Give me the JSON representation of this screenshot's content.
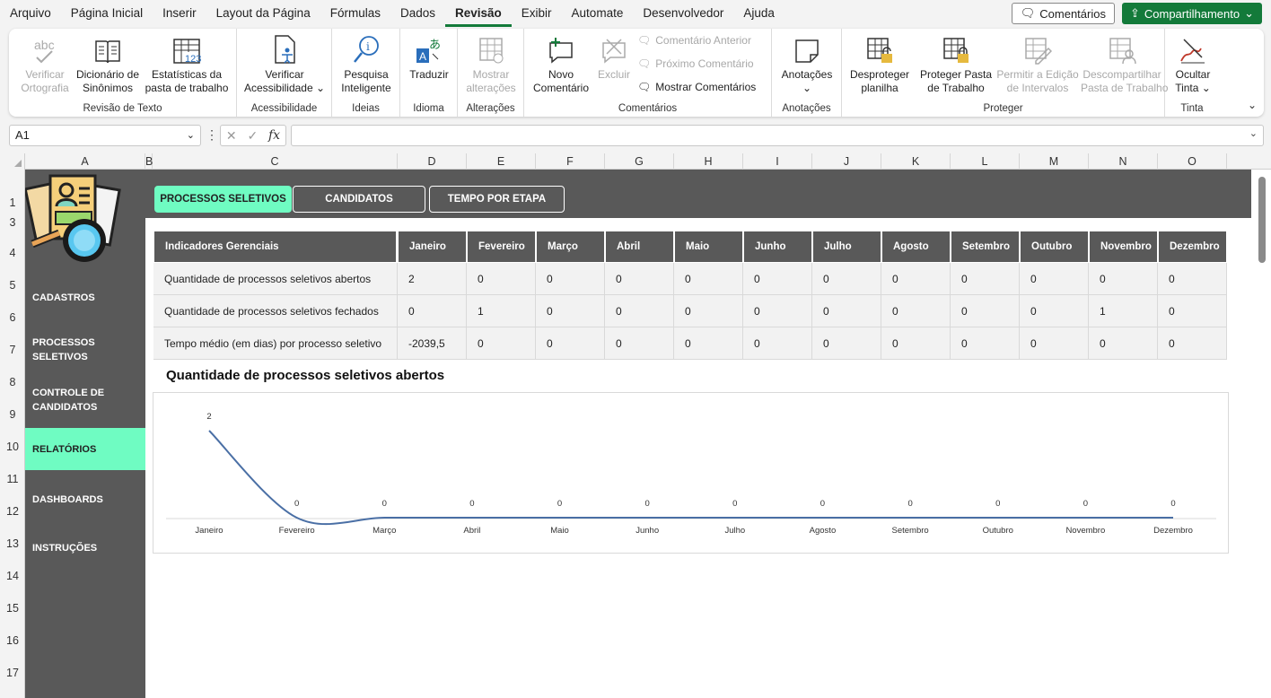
{
  "menu": [
    "Arquivo",
    "Página Inicial",
    "Inserir",
    "Layout da Página",
    "Fórmulas",
    "Dados",
    "Revisão",
    "Exibir",
    "Automate",
    "Desenvolvedor",
    "Ajuda"
  ],
  "active_menu": "Revisão",
  "top_buttons": {
    "comments": "Comentários",
    "share": "Compartilhamento"
  },
  "ribbon": {
    "revisao_texto": {
      "label": "Revisão de Texto",
      "verificar": "Verificar\nOrtografia",
      "dicionario": "Dicionário de\nSinônimos",
      "estatisticas": "Estatísticas da\npasta de trabalho"
    },
    "acessibilidade": {
      "label": "Acessibilidade",
      "verificar": "Verificar\nAcessibilidade ⌄"
    },
    "ideias": {
      "label": "Ideias",
      "pesquisa": "Pesquisa\nInteligente"
    },
    "idioma": {
      "label": "Idioma",
      "traduzir": "Traduzir"
    },
    "alteracoes": {
      "label": "Alterações",
      "mostrar": "Mostrar\nalterações"
    },
    "comentarios": {
      "label": "Comentários",
      "novo": "Novo\nComentário",
      "excluir": "Excluir",
      "anterior": "Comentário Anterior",
      "proximo": "Próximo Comentário",
      "mostrar": "Mostrar Comentários"
    },
    "anotacoes": {
      "label": "Anotações",
      "anotacoes": "Anotações\n⌄"
    },
    "proteger": {
      "label": "Proteger",
      "desproteger": "Desproteger\nplanilha",
      "proteger_pasta": "Proteger Pasta\nde Trabalho",
      "permitir": "Permitir a Edição\nde Intervalos",
      "descompartilhar": "Descompartilhar\nPasta de Trabalho"
    },
    "tinta": {
      "label": "Tinta",
      "ocultar": "Ocultar\nTinta ⌄"
    }
  },
  "namebox": "A1",
  "columns": [
    "A",
    "B",
    "C",
    "D",
    "E",
    "F",
    "G",
    "H",
    "I",
    "J",
    "K",
    "L",
    "M",
    "N",
    "O"
  ],
  "rows": [
    "1",
    "3",
    "4",
    "5",
    "6",
    "7",
    "8",
    "9",
    "10",
    "11",
    "12",
    "13",
    "14",
    "15",
    "16",
    "17"
  ],
  "tabs": [
    "PROCESSOS SELETIVOS",
    "CANDIDATOS",
    "TEMPO POR ETAPA"
  ],
  "nav": [
    "CADASTROS",
    "PROCESSOS\nSELETIVOS",
    "CONTROLE DE\nCANDIDATOS",
    "RELATÓRIOS",
    "DASHBOARDS",
    "INSTRUÇÕES"
  ],
  "active_nav": "RELATÓRIOS",
  "table": {
    "header": [
      "Indicadores Gerenciais",
      "Janeiro",
      "Fevereiro",
      "Março",
      "Abril",
      "Maio",
      "Junho",
      "Julho",
      "Agosto",
      "Setembro",
      "Outubro",
      "Novembro",
      "Dezembro"
    ],
    "rows": [
      [
        "Quantidade de processos seletivos abertos",
        "2",
        "0",
        "0",
        "0",
        "0",
        "0",
        "0",
        "0",
        "0",
        "0",
        "0",
        "0"
      ],
      [
        "Quantidade de processos seletivos fechados",
        "0",
        "1",
        "0",
        "0",
        "0",
        "0",
        "0",
        "0",
        "0",
        "0",
        "1",
        "0"
      ],
      [
        "Tempo médio (em dias) por processo seletivo",
        "-2039,5",
        "0",
        "0",
        "0",
        "0",
        "0",
        "0",
        "0",
        "0",
        "0",
        "0",
        "0"
      ]
    ]
  },
  "chart_data": {
    "type": "line",
    "title": "Quantidade de processos seletivos abertos",
    "categories": [
      "Janeiro",
      "Fevereiro",
      "Março",
      "Abril",
      "Maio",
      "Junho",
      "Julho",
      "Agosto",
      "Setembro",
      "Outubro",
      "Novembro",
      "Dezembro"
    ],
    "values": [
      2,
      0,
      0,
      0,
      0,
      0,
      0,
      0,
      0,
      0,
      0,
      0
    ],
    "data_labels": [
      "2",
      "0",
      "0",
      "0",
      "0",
      "0",
      "0",
      "0",
      "0",
      "0",
      "0",
      "0"
    ],
    "ylim": [
      0,
      2
    ],
    "grid": false,
    "smooth": true,
    "color": "#4a6fa5"
  },
  "colors": {
    "accent": "#6ffcc2",
    "dark": "#595959",
    "excel_green": "#137a3a"
  }
}
